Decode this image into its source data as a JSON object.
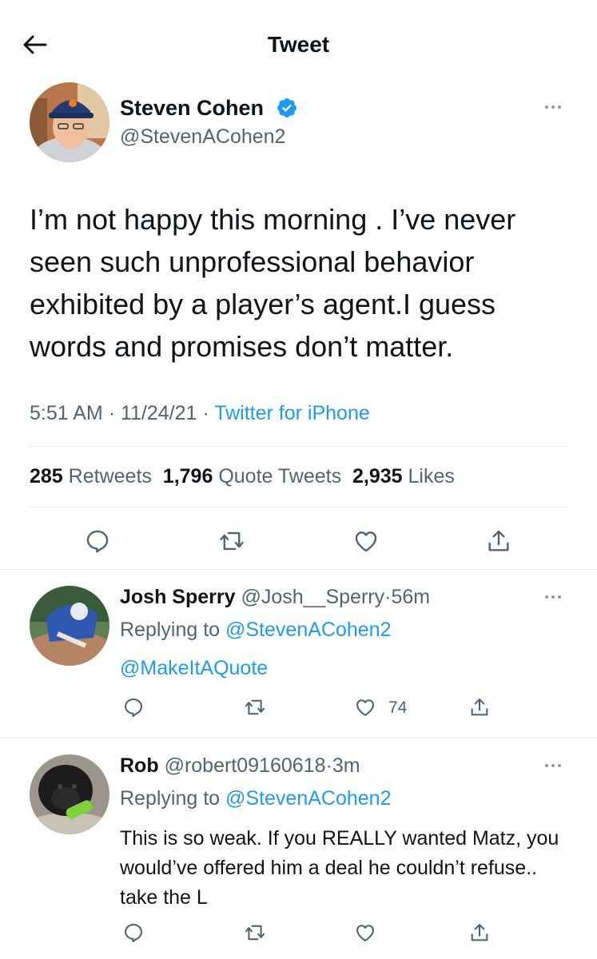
{
  "header": {
    "title": "Tweet"
  },
  "tweet": {
    "name": "Steven Cohen",
    "handle": "@StevenACohen2",
    "text": "I’m not happy this morning . I’ve never seen such unprofessional behavior exhibited by a player’s agent.I guess words and promises don’t matter.",
    "time": "5:51 AM",
    "date": "11/24/21",
    "source": "Twitter for iPhone",
    "sep": "·",
    "stats": {
      "retweets_count": "285",
      "retweets_label": "Retweets",
      "quotes_count": "1,796",
      "quotes_label": "Quote Tweets",
      "likes_count": "2,935",
      "likes_label": "Likes"
    }
  },
  "replies": [
    {
      "name": "Josh Sperry",
      "handle": "@Josh__Sperry",
      "time": "56m",
      "replying_label": "Replying to",
      "replying_to": "@StevenACohen2",
      "text": "@MakeItAQuote",
      "likes": "74"
    },
    {
      "name": "Rob",
      "handle": "@robert09160618",
      "time": "3m",
      "replying_label": "Replying to",
      "replying_to": "@StevenACohen2",
      "text": "This is so weak. If you REALLY wanted Matz, you would’ve offered him a deal he couldn’t refuse.. take the L"
    }
  ],
  "colors": {
    "accent": "#1d9bf0",
    "muted": "#536471",
    "divider": "#e6ecf0"
  }
}
